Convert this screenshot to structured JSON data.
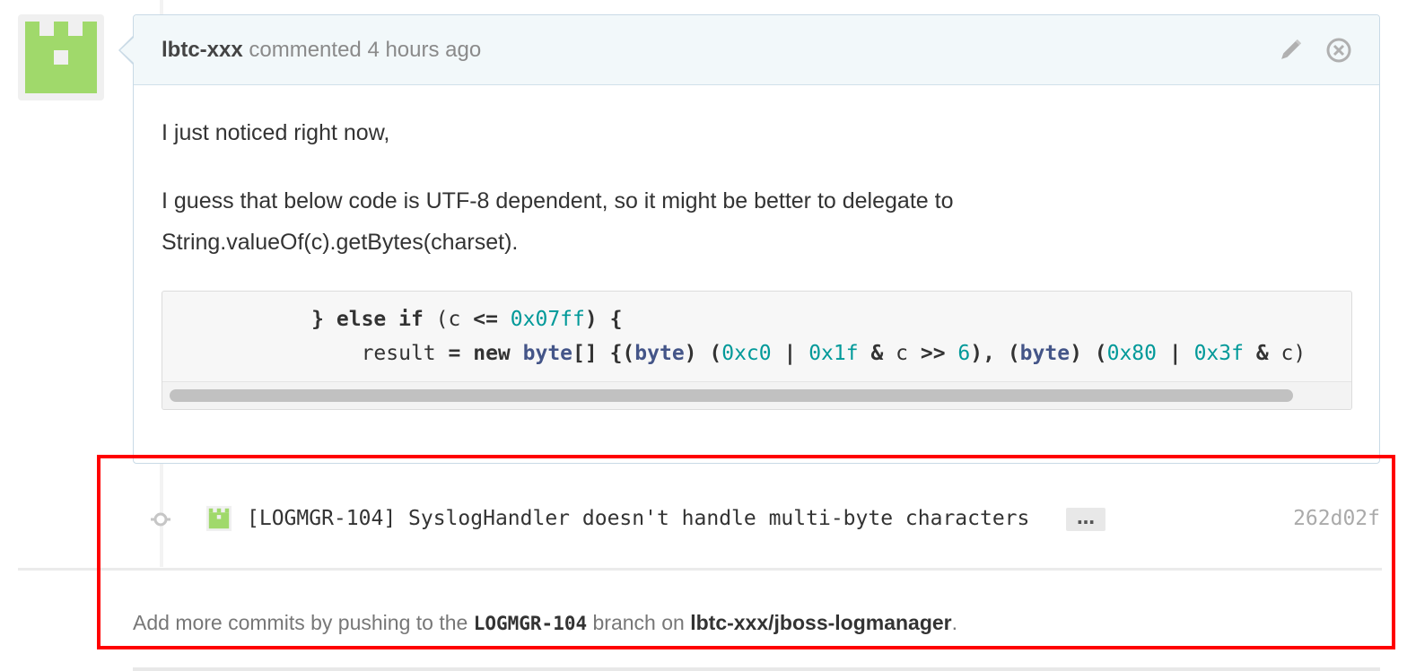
{
  "comment": {
    "author": "lbtc-xxx",
    "action": "commented",
    "time": "4 hours ago",
    "paragraph1": "I just noticed right now,",
    "paragraph2_line1": "I guess that below code is UTF-8 dependent, so it might be better to delegate to",
    "paragraph2_line2": "String.valueOf(c).getBytes(charset).",
    "code": {
      "line1": {
        "indent": "            ",
        "brace": "} ",
        "kw_else": "else",
        "kw_if": "if",
        "paren_open": " (c ",
        "op_le": "<=",
        "num": "0x07ff",
        "tail": ") {"
      },
      "line2": {
        "indent": "                ",
        "var": "result ",
        "eq": "=",
        "kw_new": "new",
        "ty_byte": "byte",
        "brackets": "[] ",
        "brace_open": "{",
        "cast_open": "(",
        "cast_type": "byte",
        "cast_close": ") (",
        "n1": "0xc0",
        "pipe": "|",
        "n2": "0x1f",
        "amp": "&",
        "c_shift": " c ",
        "shift": ">>",
        "n3": "6",
        "sep": "), ",
        "cast2_open": "(",
        "cast2_type": "byte",
        "cast2_close": ") (",
        "n4": "0x80",
        "pipe2": "|",
        "n5": "0x3f",
        "amp2": "&",
        "tail": " c)"
      }
    },
    "icons": {
      "edit": "pencil-icon",
      "delete": "close-circle-icon"
    }
  },
  "commit": {
    "message": "[LOGMGR-104] SyslogHandler doesn't handle multi-byte characters",
    "expand_label": "…",
    "sha": "262d02f"
  },
  "footer": {
    "prefix": "Add more commits by pushing to the",
    "branch": "LOGMGR-104",
    "middle": "branch on",
    "repo": "lbtc-xxx/jboss-logmanager",
    "suffix": "."
  },
  "colors": {
    "avatar_green": "#a0d96b",
    "header_bg": "#f2f8fa",
    "highlight": "#ff0000"
  }
}
